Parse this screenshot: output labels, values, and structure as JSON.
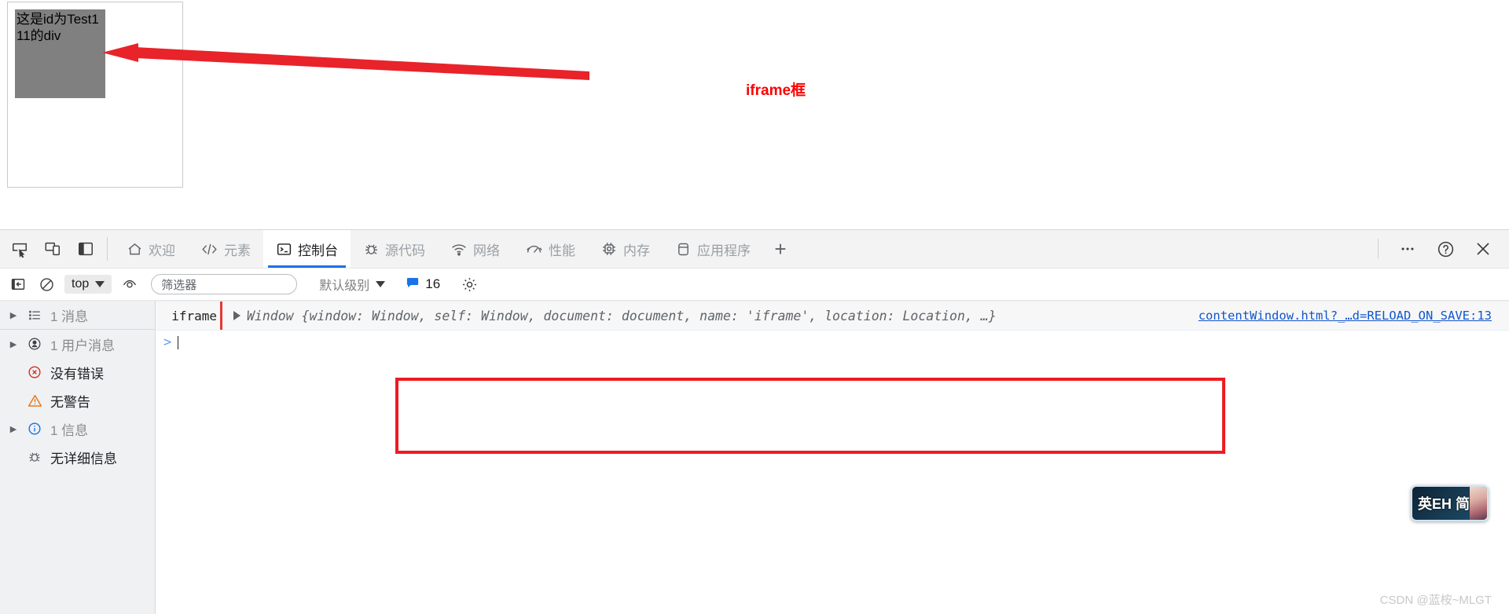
{
  "page": {
    "iframe_div_text": "这是id为Test111的div",
    "annotation_label": "iframe框",
    "annotation_color": "#ff0000"
  },
  "devtools": {
    "left_icons": [
      {
        "name": "inspect-element-icon"
      },
      {
        "name": "device-toolbar-icon"
      },
      {
        "name": "dock-panel-icon"
      }
    ],
    "tabs": [
      {
        "label": "欢迎",
        "icon": "home-icon",
        "active": false
      },
      {
        "label": "元素",
        "icon": "code-brackets-icon",
        "active": false
      },
      {
        "label": "控制台",
        "icon": "console-terminal-icon",
        "active": true
      },
      {
        "label": "源代码",
        "icon": "bug-icon",
        "active": false
      },
      {
        "label": "网络",
        "icon": "wifi-icon",
        "active": false
      },
      {
        "label": "性能",
        "icon": "gauge-icon",
        "active": false
      },
      {
        "label": "内存",
        "icon": "memory-chip-icon",
        "active": false
      },
      {
        "label": "应用程序",
        "icon": "database-icon",
        "active": false
      }
    ],
    "add_tab_label": "+",
    "right_icons": [
      {
        "name": "more-options-icon",
        "glyph": "…"
      },
      {
        "name": "help-icon",
        "glyph": "?"
      },
      {
        "name": "close-devtools-icon",
        "glyph": "✕"
      }
    ],
    "accent_color": "#1a73e8"
  },
  "console_toolbar": {
    "sidebar_toggle": "console-sidebar-toggle-icon",
    "clear_console": "clear-console-icon",
    "context_value": "top",
    "live_expression": "eye-icon",
    "filter_placeholder": "筛选器",
    "filter_value": "",
    "level_label": "默认级别",
    "message_count": "16",
    "settings_icon": "gear-icon",
    "badge_color": "#1a73e8"
  },
  "console_sidebar": {
    "items": [
      {
        "label": "1 消息",
        "icon": "list-icon",
        "expandable": true,
        "muted": true
      },
      {
        "label": "1 用户消息",
        "icon": "user-message-icon",
        "expandable": true,
        "muted": true
      },
      {
        "label": "没有错误",
        "icon": "error-circle-icon",
        "expandable": false,
        "muted": false
      },
      {
        "label": "无警告",
        "icon": "warning-triangle-icon",
        "expandable": false,
        "muted": false
      },
      {
        "label": "1 信息",
        "icon": "info-circle-icon",
        "expandable": true,
        "muted": true
      },
      {
        "label": "无详细信息",
        "icon": "bug-icon",
        "expandable": false,
        "muted": false
      }
    ]
  },
  "console_output": {
    "row": {
      "origin": "iframe",
      "expand_icon": "disclosure-triangle-icon",
      "preview_class": "Window",
      "preview_props": "{window: Window, self: Window, document: document, name: 'iframe', location: Location, …}",
      "source_link": "contentWindow.html?_…d=RELOAD_ON_SAVE:13"
    },
    "prompt": {
      "caret": ">",
      "value": ""
    }
  },
  "highlight_box": {
    "color": "#ec1c24"
  },
  "ime": {
    "text": "英EH 简"
  },
  "watermark": {
    "text": "CSDN @蓝桉~MLGT"
  }
}
